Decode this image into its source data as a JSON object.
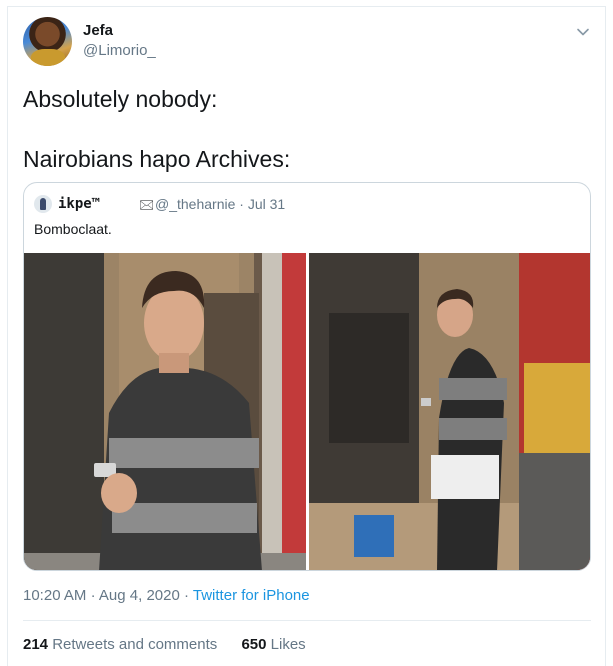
{
  "tweet": {
    "display_name": "Jefa",
    "handle": "@Limorio_",
    "text_line1": "Absolutely nobody:",
    "text_line2": "Nairobians hapo Archives:",
    "time": "10:20 AM",
    "date": "Aug 4, 2020",
    "source": "Twitter for iPhone",
    "retweets_count": "214",
    "retweets_label": "Retweets and comments",
    "likes_count": "650",
    "likes_label": "Likes",
    "caret_icon": "chevron-down-icon"
  },
  "quoted": {
    "name": "ikpe™",
    "mail_icon": "🖂",
    "handle_date": "@_theharnie · Jul 31",
    "text": "Bomboclaat."
  },
  "colors": {
    "link": "#1b95e0",
    "muted": "#657786",
    "text": "#14171a",
    "border": "#ccd6dd"
  }
}
